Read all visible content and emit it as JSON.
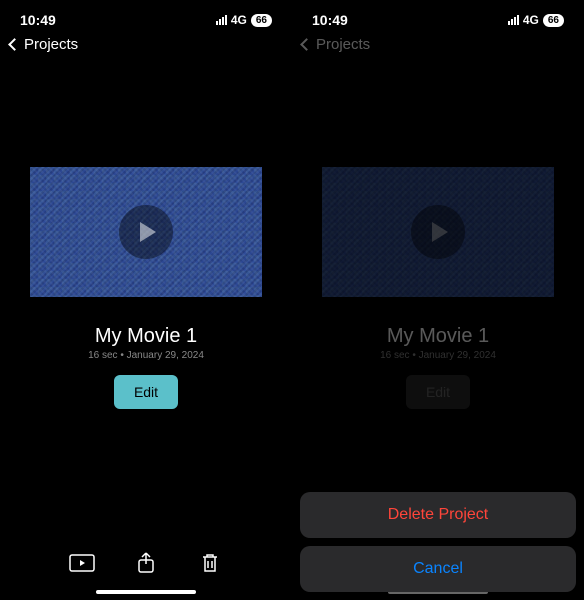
{
  "status": {
    "time": "10:49",
    "network": "4G",
    "battery": "66"
  },
  "nav": {
    "back_label": "Projects"
  },
  "movie": {
    "title": "My Movie 1",
    "duration": "16 sec",
    "date": "January 29, 2024",
    "subtitle": "16 sec • January 29, 2024"
  },
  "buttons": {
    "edit": "Edit"
  },
  "action_sheet": {
    "delete": "Delete Project",
    "cancel": "Cancel"
  }
}
